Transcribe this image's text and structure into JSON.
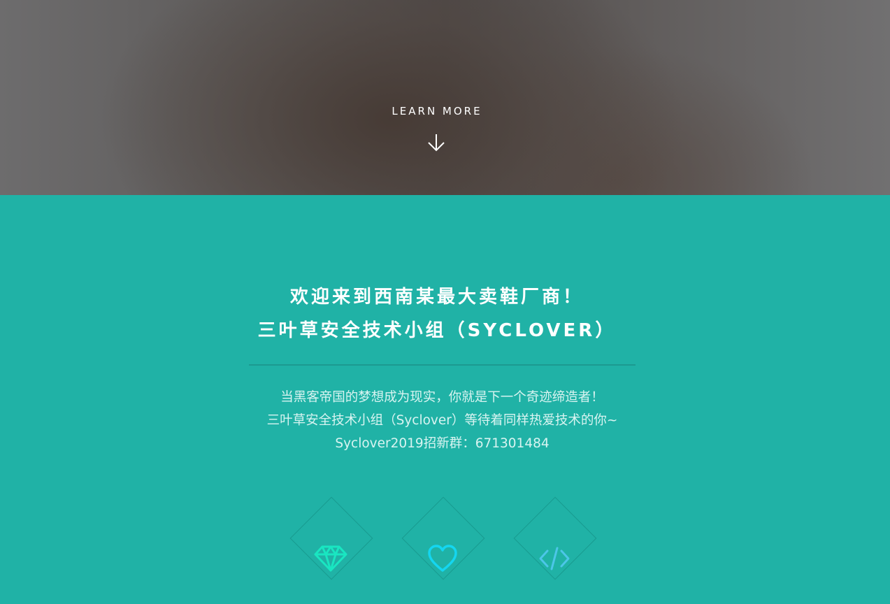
{
  "banner": {
    "learn_more_label": "LEARN MORE",
    "arrow_icon": "arrow-down-icon"
  },
  "intro": {
    "headline_line1": "欢迎来到西南某最大卖鞋厂商！",
    "headline_line2": "三叶草安全技术小组（SYCLOVER）",
    "text_line1": "当黑客帝国的梦想成为现实，你就是下一个奇迹缔造者！",
    "text_line2": "三叶草安全技术小组（Syclover）等待着同样热爱技术的你~",
    "text_line3": "Syclover2019招新群：671301484"
  },
  "features": [
    {
      "icon": "diamond-gem-icon",
      "color": "#19e6c1"
    },
    {
      "icon": "heart-icon",
      "color": "#14d6f0"
    },
    {
      "icon": "code-icon",
      "color": "#4cc6e8"
    }
  ],
  "colors": {
    "section_bg": "#20b2a6",
    "divider": "#1c9a90",
    "banner_text": "#ffffff"
  }
}
